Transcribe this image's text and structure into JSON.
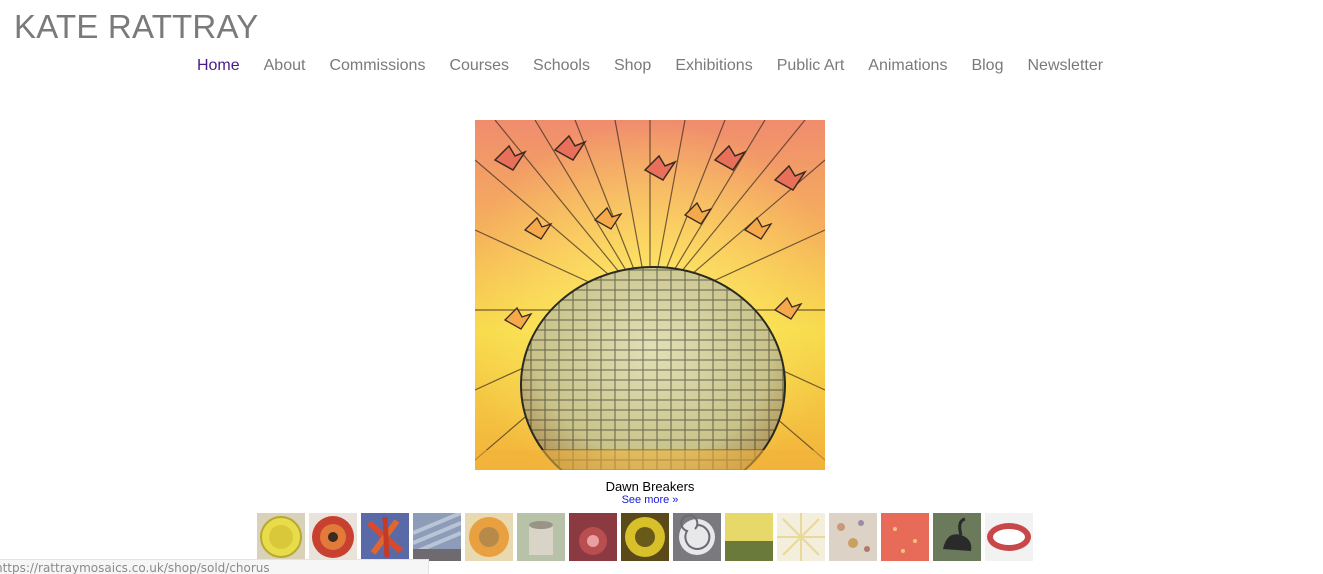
{
  "site": {
    "title": "KATE RATTRAY"
  },
  "nav": {
    "items": [
      {
        "label": "Home",
        "active": true
      },
      {
        "label": "About"
      },
      {
        "label": "Commissions"
      },
      {
        "label": "Courses"
      },
      {
        "label": "Schools"
      },
      {
        "label": "Shop"
      },
      {
        "label": "Exhibitions"
      },
      {
        "label": "Public Art"
      },
      {
        "label": "Animations"
      },
      {
        "label": "Blog"
      },
      {
        "label": "Newsletter"
      }
    ],
    "active_color": "#4b1a8a",
    "color": "#7a7a7a"
  },
  "feature": {
    "caption": "Dawn Breakers",
    "see_more": "See more »"
  },
  "thumbnails": [
    {
      "icon": "yellow-sunflower-mosaic-thumbnail"
    },
    {
      "icon": "red-circle-mosaic-thumbnail"
    },
    {
      "icon": "chilli-peppers-mosaic-thumbnail"
    },
    {
      "icon": "blue-grey-mosaic-thumbnail"
    },
    {
      "icon": "golden-sunflower-mosaic-thumbnail"
    },
    {
      "icon": "tree-stump-mosaic-thumbnail"
    },
    {
      "icon": "red-flower-mosaic-thumbnail"
    },
    {
      "icon": "dark-sunflower-mosaic-thumbnail"
    },
    {
      "icon": "silver-spiral-mosaic-thumbnail"
    },
    {
      "icon": "yellow-field-mosaic-thumbnail"
    },
    {
      "icon": "pale-sunburst-mosaic-thumbnail"
    },
    {
      "icon": "scattered-pattern-mosaic-thumbnail"
    },
    {
      "icon": "coral-red-mosaic-thumbnail"
    },
    {
      "icon": "swan-mosaic-thumbnail"
    },
    {
      "icon": "lips-mosaic-thumbnail"
    }
  ],
  "status_bar": {
    "url": "https://rattraymosaics.co.uk/shop/sold/chorus"
  }
}
